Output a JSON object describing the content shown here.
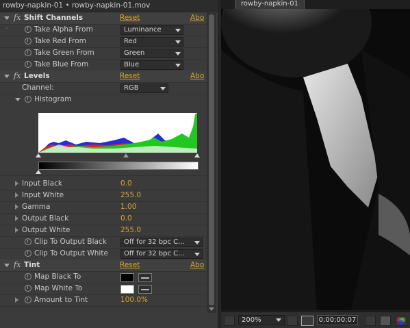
{
  "panel": {
    "title": "rowby-napkin-01 • rowby-napkin-01.mov",
    "effects": {
      "shift": {
        "name": "Shift Channels",
        "reset": "Reset",
        "about": "Abo",
        "props": [
          {
            "label": "Take Alpha From",
            "value": "Luminance"
          },
          {
            "label": "Take Red From",
            "value": "Red"
          },
          {
            "label": "Take Green From",
            "value": "Green"
          },
          {
            "label": "Take Blue From",
            "value": "Blue"
          }
        ]
      },
      "levels": {
        "name": "Levels",
        "reset": "Reset",
        "about": "Abo",
        "channel_label": "Channel:",
        "channel_value": "RGB",
        "histogram_label": "Histogram",
        "props": [
          {
            "label": "Input Black",
            "value": "0.0"
          },
          {
            "label": "Input White",
            "value": "255.0"
          },
          {
            "label": "Gamma",
            "value": "1.00"
          },
          {
            "label": "Output Black",
            "value": "0.0"
          },
          {
            "label": "Output White",
            "value": "255.0"
          }
        ],
        "clip_black_label": "Clip To Output Black",
        "clip_black_value": "Off for 32 bpc C...",
        "clip_white_label": "Clip To Output White",
        "clip_white_value": "Off for 32 bpc C..."
      },
      "tint": {
        "name": "Tint",
        "reset": "Reset",
        "about": "Abo",
        "map_black_label": "Map Black To",
        "map_black_color": "#000000",
        "map_white_label": "Map White To",
        "map_white_color": "#ffffff",
        "amount_label": "Amount to Tint",
        "amount_value": "100.0%"
      }
    }
  },
  "comp": {
    "tab": "rowby-napkin-01",
    "zoom": "200%",
    "timecode": "0;00;00;07"
  },
  "colors": {
    "link": "#d9a532",
    "panel_bg": "#3b3b3b"
  },
  "icons": [
    "fx-icon",
    "stopwatch-icon",
    "expand-triangle-icon",
    "dropdown-arrow-icon",
    "eyedropper-icon",
    "region-of-interest-icon",
    "transparency-grid-icon",
    "snapshot-icon",
    "channel-icon",
    "show-snapshot-icon"
  ]
}
